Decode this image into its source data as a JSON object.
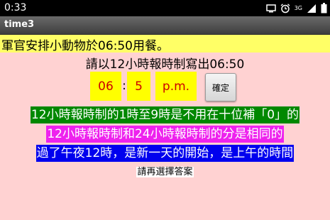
{
  "status_bar": {
    "time": "0:33",
    "network_label": "3G",
    "icons": [
      "screen-icon",
      "alarm-icon",
      "signal-icon",
      "battery-icon"
    ]
  },
  "app": {
    "title": "time3"
  },
  "question": {
    "prompt": "軍官安排小動物於06:50用餐。"
  },
  "instruction": {
    "text": "請以12小時報時制寫出06:50"
  },
  "answer": {
    "hour": "06",
    "separator": ":",
    "minute": "5",
    "period": "p.m."
  },
  "confirm_button": {
    "label": "確定"
  },
  "hints": [
    {
      "text": "12小時報時制的1時至9時是不用在十位補「0」的",
      "background": "#008800"
    },
    {
      "text": "12小時報時制和24小時報時制的分是相同的",
      "background": "#ee22ee"
    },
    {
      "text": "過了午夜12時，是新一天的開始，是上午的時間",
      "background": "#0000ee"
    }
  ],
  "feedback": {
    "text": "請再選擇答案"
  },
  "colors": {
    "page_background": "#ffd2d2",
    "prompt_background": "#ffff66",
    "answer_field_background": "#ffff00",
    "answer_text": "#cc0000"
  }
}
